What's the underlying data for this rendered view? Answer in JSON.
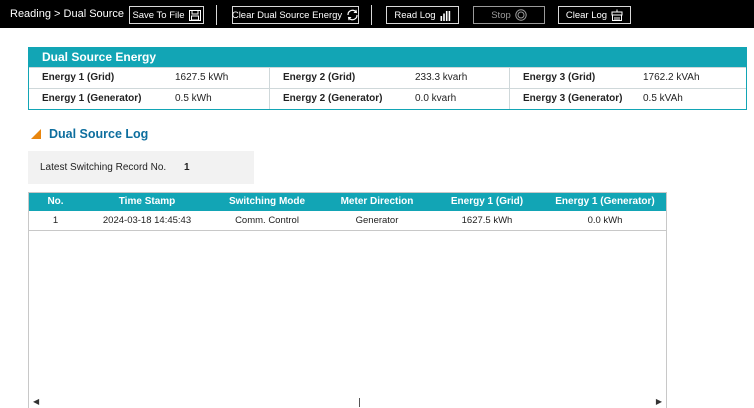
{
  "toolbar": {
    "breadcrumb": "Reading > Dual Source",
    "buttons": {
      "save_to_file": "Save To File",
      "clear_energy": "Clear Dual Source Energy",
      "read_log": "Read Log",
      "stop": "Stop",
      "clear_log": "Clear Log"
    }
  },
  "energy_panel": {
    "title": "Dual Source Energy",
    "rows": [
      [
        {
          "label": "Energy 1 (Grid)",
          "value": "1627.5 kWh"
        },
        {
          "label": "Energy 2 (Grid)",
          "value": "233.3 kvarh"
        },
        {
          "label": "Energy 3 (Grid)",
          "value": "1762.2 kVAh"
        }
      ],
      [
        {
          "label": "Energy 1 (Generator)",
          "value": "0.5 kWh"
        },
        {
          "label": "Energy 2 (Generator)",
          "value": "0.0 kvarh"
        },
        {
          "label": "Energy 3 (Generator)",
          "value": "0.5 kVAh"
        }
      ]
    ]
  },
  "log": {
    "title": "Dual Source Log",
    "latest_label": "Latest Switching Record No.",
    "latest_value": "1",
    "columns": [
      "No.",
      "Time Stamp",
      "Switching Mode",
      "Meter Direction",
      "Energy 1 (Grid)",
      "Energy 1 (Generator)"
    ],
    "rows": [
      [
        "1",
        "2024-03-18 14:45:43",
        "Comm. Control",
        "Generator",
        "1627.5 kWh",
        "0.0 kWh"
      ]
    ]
  },
  "colors": {
    "accent": "#12a5b5",
    "section_title": "#0d6e9e",
    "marker": "#e8860f",
    "toolbar_bg": "#000000"
  },
  "icons": {
    "save": "floppy-disk-icon",
    "clear_energy": "refresh-icon",
    "read_log": "bar-chart-icon",
    "stop": "stop-circle-icon",
    "clear_log": "clear-log-icon"
  }
}
